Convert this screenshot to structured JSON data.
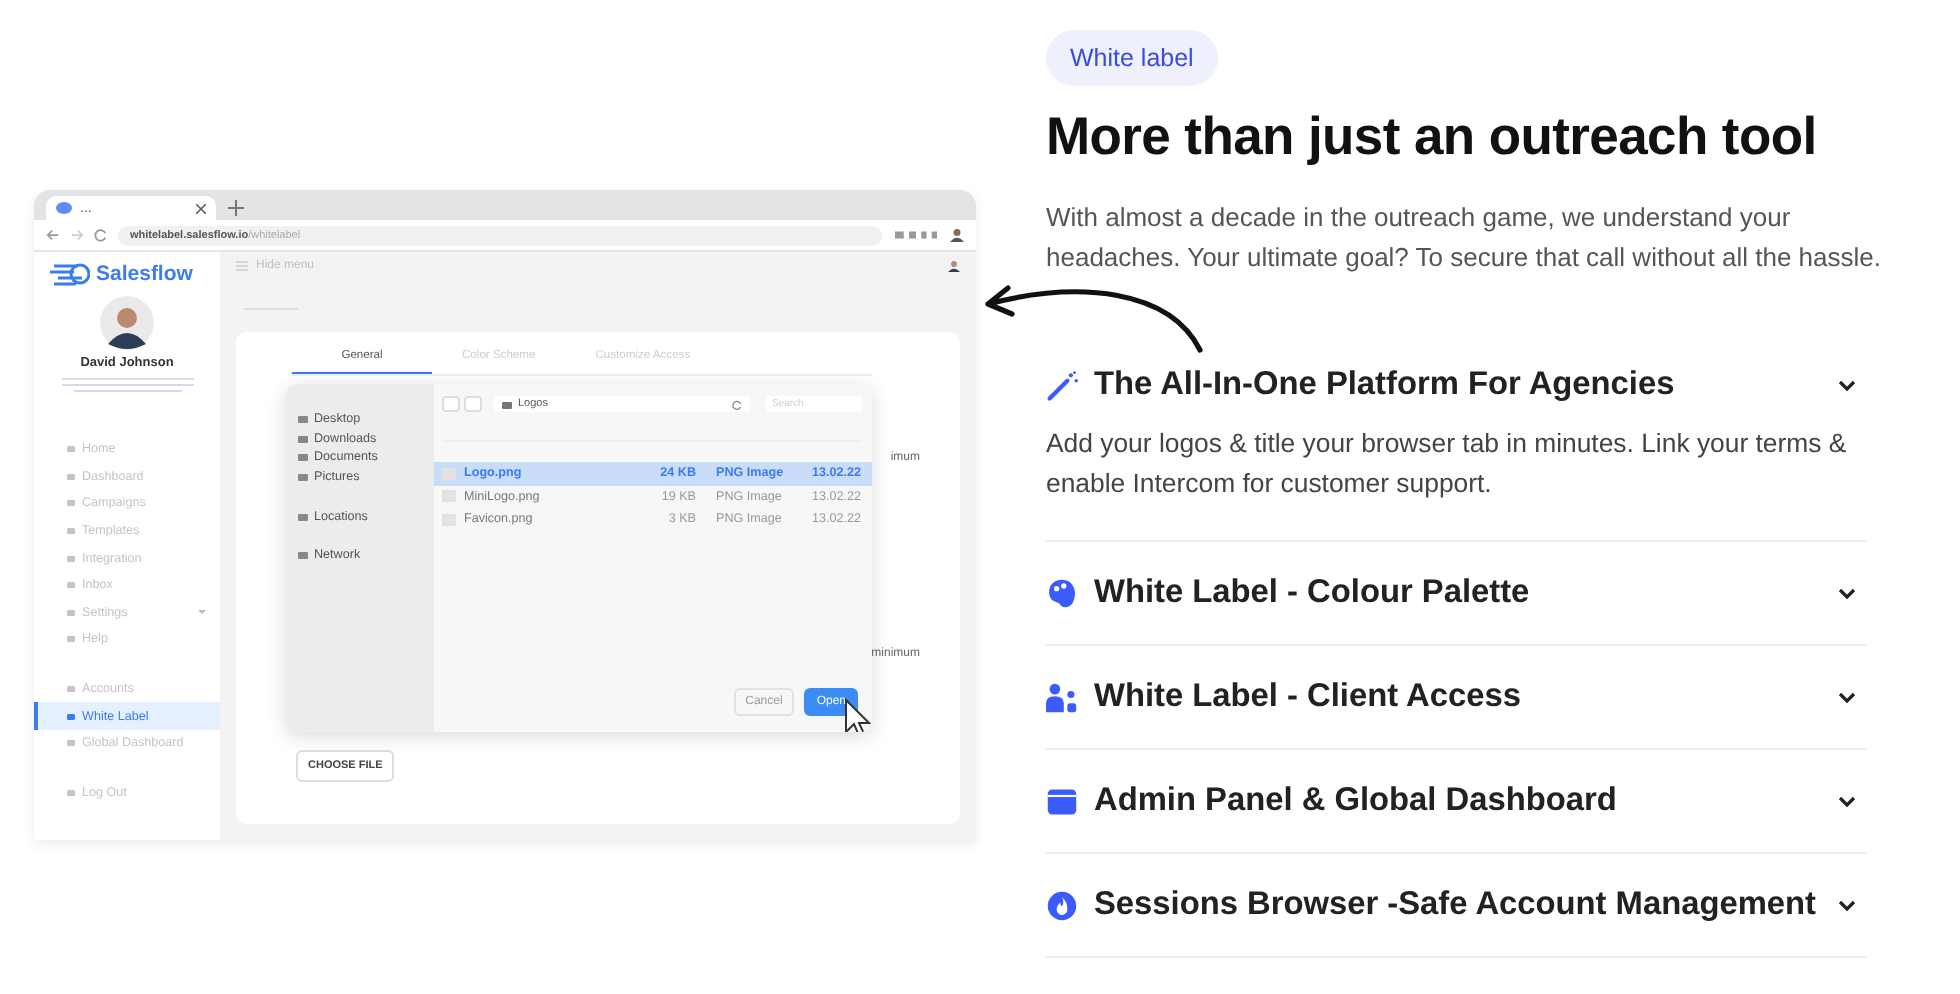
{
  "mockup": {
    "browser": {
      "tab_title": "...",
      "url": "**whitelabel.salesflow.io**/whitelabel"
    },
    "sidebar": {
      "logo": "Salesflow",
      "user_name": "David Johnson",
      "nav_groups": [
        [
          {
            "label": "Home",
            "selected": false
          },
          {
            "label": "Dashboard",
            "selected": false
          },
          {
            "label": "Campaigns",
            "selected": false
          },
          {
            "label": "Templates",
            "selected": false
          },
          {
            "label": "Integration",
            "selected": false
          },
          {
            "label": "Inbox",
            "selected": false
          },
          {
            "label": "Settings",
            "selected": false,
            "expandable": true
          },
          {
            "label": "Help",
            "selected": false
          }
        ],
        [
          {
            "label": "Accounts",
            "selected": false
          },
          {
            "label": "White Label",
            "selected": true
          },
          {
            "label": "Global Dashboard",
            "selected": false
          }
        ],
        [
          {
            "label": "Log Out",
            "selected": false
          }
        ]
      ]
    },
    "topbar": {
      "hide_menu": "Hide menu"
    },
    "tabs": [
      {
        "label": "General",
        "selected": true
      },
      {
        "label": "Color Scheme",
        "selected": false
      },
      {
        "label": "Customize Access",
        "selected": false
      }
    ],
    "partial_texts": [
      "imum",
      "minimum"
    ],
    "choose_file": "CHOOSE FILE",
    "file_dialog": {
      "places": [
        {
          "label": "Desktop"
        },
        {
          "label": "Downloads"
        },
        {
          "label": "Documents"
        },
        {
          "label": "Pictures"
        },
        {
          "label": "Locations",
          "section": true
        },
        {
          "label": "Network",
          "section": true
        }
      ],
      "path": "Logos",
      "search_placeholder": "Search",
      "files": [
        {
          "name": "Logo.png",
          "size": "24 KB",
          "type": "PNG Image",
          "date": "13.02.22",
          "selected": true
        },
        {
          "name": "MiniLogo.png",
          "size": "19 KB",
          "type": "PNG Image",
          "date": "13.02.22",
          "selected": false
        },
        {
          "name": "Favicon.png",
          "size": "3 KB",
          "type": "PNG Image",
          "date": "13.02.22",
          "selected": false
        }
      ],
      "buttons": [
        {
          "label": "Cancel",
          "primary": false
        },
        {
          "label": "Open",
          "primary": true
        }
      ]
    }
  },
  "badge": "White label",
  "heading": "More than just an outreach tool",
  "intro": "With almost a decade in the outreach game, we understand your headaches. Your ultimate goal? To secure that call without all the hassle.",
  "accordion": [
    {
      "title": "The All-In-One Platform For Agencies",
      "expanded": true,
      "body": "Add your logos & title your browser tab in minutes. Link your terms & enable Intercom for customer support."
    },
    {
      "title": "White Label - Colour Palette",
      "expanded": false
    },
    {
      "title": "White Label - Client Access",
      "expanded": false
    },
    {
      "title": "Admin Panel & Global Dashboard",
      "expanded": false
    },
    {
      "title": "Sessions Browser -Safe Account Management",
      "expanded": false
    }
  ]
}
